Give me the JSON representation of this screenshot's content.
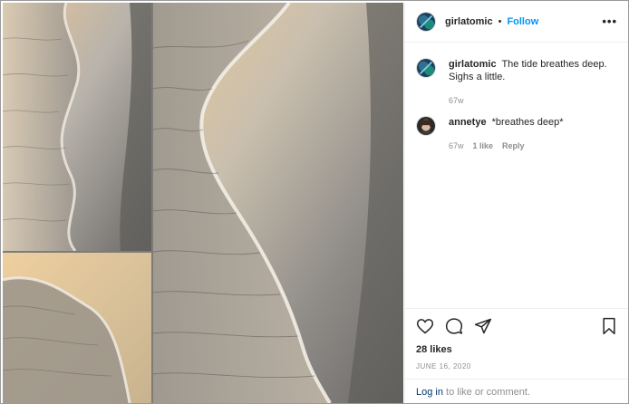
{
  "post": {
    "username": "girlatomic",
    "separator": "•",
    "follow_label": "Follow",
    "more_label": "•••"
  },
  "comments": [
    {
      "username": "girlatomic",
      "text": "The tide breathes deep. Sighs a little.",
      "age": "67w"
    },
    {
      "username": "annetye",
      "text": "*breathes deep*",
      "age": "67w",
      "likes": "1 like",
      "reply": "Reply"
    }
  ],
  "actions": {
    "icons": [
      "heart-icon",
      "comment-icon",
      "share-icon",
      "bookmark-icon"
    ]
  },
  "likes": "28 likes",
  "date": "JUNE 16, 2020",
  "login": {
    "link": "Log in",
    "rest": " to like or comment."
  },
  "colors": {
    "accent": "#0095f6",
    "sand_light": "#e8c79a",
    "sand_dark": "#6f6d6a"
  }
}
